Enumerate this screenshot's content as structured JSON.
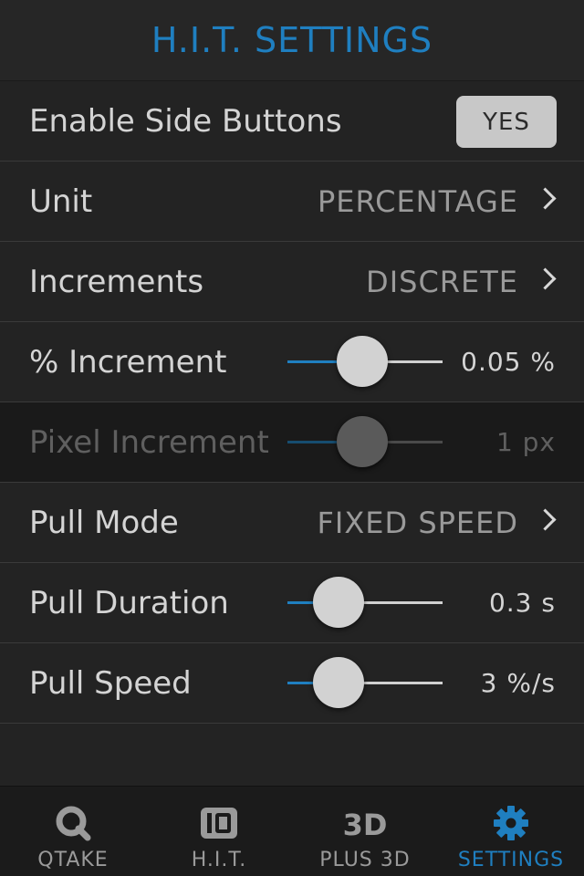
{
  "header": {
    "title": "H.I.T. SETTINGS"
  },
  "rows": {
    "side_buttons": {
      "label": "Enable Side Buttons",
      "button": "YES"
    },
    "unit": {
      "label": "Unit",
      "value": "PERCENTAGE"
    },
    "increments": {
      "label": "Increments",
      "value": "DISCRETE"
    },
    "percent_increment": {
      "label": "% Increment",
      "value": "0.05 %",
      "slider_level": 0.48
    },
    "pixel_increment": {
      "label": "Pixel Increment",
      "value": "1 px",
      "slider_level": 0.48,
      "disabled": true
    },
    "pull_mode": {
      "label": "Pull Mode",
      "value": "FIXED SPEED"
    },
    "pull_duration": {
      "label": "Pull Duration",
      "value": "0.3 s",
      "slider_level": 0.33
    },
    "pull_speed": {
      "label": "Pull Speed",
      "value": "3 %/s",
      "slider_level": 0.33
    }
  },
  "tabbar": {
    "tabs": [
      {
        "label": "QTAKE",
        "icon": "qtake-icon"
      },
      {
        "label": "H.I.T.",
        "icon": "hit-icon"
      },
      {
        "label": "PLUS 3D",
        "icon": "plus-3d-icon"
      },
      {
        "label": "SETTINGS",
        "icon": "gear-icon",
        "active": true
      }
    ]
  },
  "colors": {
    "accent": "#1f7fc0",
    "background": "#232323",
    "tabbar": "#1b1b1b"
  }
}
